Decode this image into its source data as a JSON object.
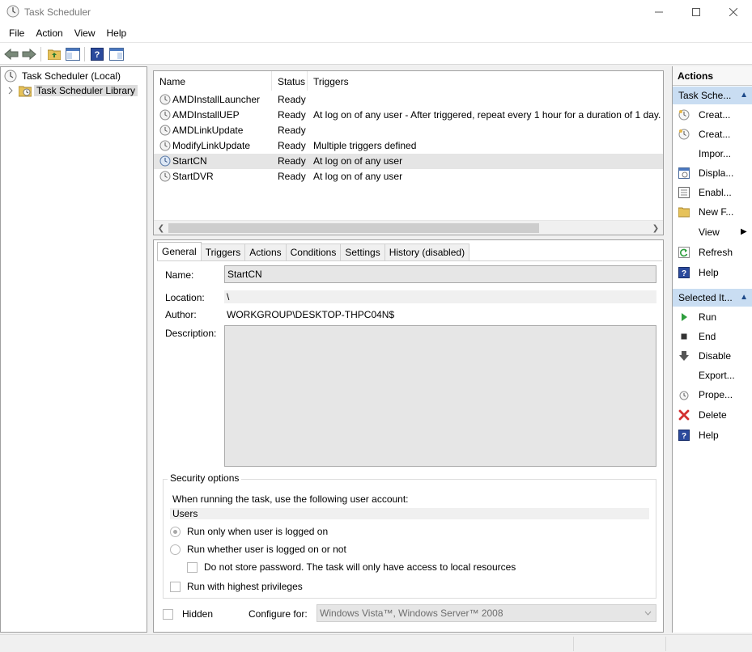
{
  "window": {
    "title": "Task Scheduler"
  },
  "menu": [
    "File",
    "Action",
    "View",
    "Help"
  ],
  "tree": {
    "root": "Task Scheduler (Local)",
    "library": "Task Scheduler Library"
  },
  "task_list": {
    "columns": [
      "Name",
      "Status",
      "Triggers"
    ],
    "rows": [
      {
        "name": "AMDInstallLauncher",
        "status": "Ready",
        "triggers": ""
      },
      {
        "name": "AMDInstallUEP",
        "status": "Ready",
        "triggers": "At log on of any user - After triggered, repeat every 1 hour for a duration of 1 day."
      },
      {
        "name": "AMDLinkUpdate",
        "status": "Ready",
        "triggers": ""
      },
      {
        "name": "ModifyLinkUpdate",
        "status": "Ready",
        "triggers": "Multiple triggers defined"
      },
      {
        "name": "StartCN",
        "status": "Ready",
        "triggers": "At log on of any user",
        "selected": true
      },
      {
        "name": "StartDVR",
        "status": "Ready",
        "triggers": "At log on of any user"
      }
    ]
  },
  "details": {
    "tabs": [
      "General",
      "Triggers",
      "Actions",
      "Conditions",
      "Settings",
      "History (disabled)"
    ],
    "active_tab": "General",
    "name_label": "Name:",
    "name_value": "StartCN",
    "location_label": "Location:",
    "location_value": "\\",
    "author_label": "Author:",
    "author_value": "WORKGROUP\\DESKTOP-THPC04N$",
    "description_label": "Description:",
    "description_value": "",
    "security": {
      "title": "Security options",
      "account_prompt": "When running the task, use the following user account:",
      "account": "Users",
      "radio_logged_on": "Run only when user is logged on",
      "radio_logged_on_selected": true,
      "radio_whether": "Run whether user is logged on or not",
      "no_store_password": "Do not store password.  The task will only have access to local resources",
      "highest_privileges": "Run with highest privileges"
    },
    "hidden_label": "Hidden",
    "configure_label": "Configure for:",
    "configure_value": "Windows Vista™, Windows Server™ 2008"
  },
  "actions": {
    "title": "Actions",
    "section1": "Task Sche...",
    "section1_items": [
      {
        "label": "Creat...",
        "icon": "create-basic-task-icon"
      },
      {
        "label": "Creat...",
        "icon": "create-task-icon"
      },
      {
        "label": "Impor...",
        "icon": ""
      },
      {
        "label": "Displa...",
        "icon": "display-running-tasks-icon"
      },
      {
        "label": "Enabl...",
        "icon": "enable-history-icon"
      },
      {
        "label": "New F...",
        "icon": "new-folder-icon"
      },
      {
        "label": "View",
        "icon": ""
      },
      {
        "label": "Refresh",
        "icon": "refresh-icon"
      },
      {
        "label": "Help",
        "icon": "help-icon"
      }
    ],
    "section2": "Selected It...",
    "section2_items": [
      {
        "label": "Run",
        "icon": "run-icon"
      },
      {
        "label": "End",
        "icon": "end-icon"
      },
      {
        "label": "Disable",
        "icon": "disable-icon"
      },
      {
        "label": "Export...",
        "icon": ""
      },
      {
        "label": "Prope...",
        "icon": "properties-icon"
      },
      {
        "label": "Delete",
        "icon": "delete-icon"
      },
      {
        "label": "Help",
        "icon": "help-icon"
      }
    ]
  },
  "colors": {
    "selection": "#e5e5e5",
    "actions_section": "#c9ddf2",
    "delete_red": "#d32f2f",
    "help_blue": "#2b4a9c",
    "run_green": "#2e9e3e"
  }
}
